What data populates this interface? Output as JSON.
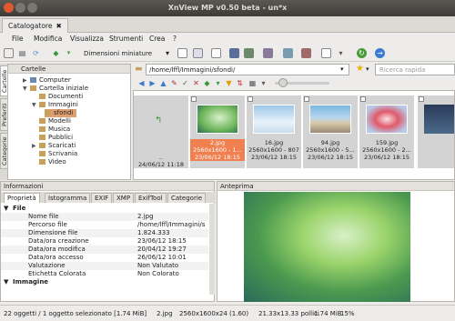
{
  "window": {
    "title": "XnView MP v0.50 beta - un*x"
  },
  "tab": {
    "label": "Catalogatore",
    "close": "✖"
  },
  "menu": [
    "File",
    "Modifica",
    "Visualizza",
    "Strumenti",
    "Crea",
    "?"
  ],
  "toolbar": {
    "dim_label": "Dimensioni miniature"
  },
  "side_tabs": [
    "Cartelle",
    "Preferiti",
    "Categorie"
  ],
  "folders": {
    "header": "Cartelle",
    "items": [
      "Computer",
      "Cartella iniziale",
      "Documenti",
      "Immagini",
      "sfondi",
      "Modelli",
      "Musica",
      "Pubblici",
      "Scaricati",
      "Scrivania",
      "Video"
    ]
  },
  "path": {
    "value": "/home/lffl/Immagini/sfondi/",
    "search_placeholder": "Ricerca rapida"
  },
  "thumbs": [
    {
      "name": "..",
      "line2": "",
      "line3": "24/06/12 11:18"
    },
    {
      "name": "2.jpg",
      "line2": "2560x1600 - 1...",
      "line3": "23/06/12 18:15"
    },
    {
      "name": "16.jpg",
      "line2": "2560x1600 - 807",
      "line3": "23/06/12 18:15"
    },
    {
      "name": "94.jpg",
      "line2": "2560x1600 - 5...",
      "line3": "23/06/12 18:15"
    },
    {
      "name": "159.jpg",
      "line2": "2560x1600 - 2...",
      "line3": "23/06/12 18:15"
    }
  ],
  "info": {
    "header": "Informazioni",
    "tabs": [
      "Proprietà",
      "Istogramma",
      "EXIF",
      "XMP",
      "ExifTool",
      "Categorie"
    ],
    "section_file": "File",
    "rows": [
      {
        "k": "Nome file",
        "v": "2.jpg"
      },
      {
        "k": "Percorso file",
        "v": "/home/lffl/Immagini/s"
      },
      {
        "k": "Dimensione file",
        "v": "1.824.333"
      },
      {
        "k": "Data/ora creazione",
        "v": "23/06/12 18:15"
      },
      {
        "k": "Data/ora modifica",
        "v": "20/04/12 19:27"
      },
      {
        "k": "Data/ora accesso",
        "v": "26/06/12 10:01"
      },
      {
        "k": "Valutazione",
        "v": "Non Valutato"
      },
      {
        "k": "Etichetta Colorata",
        "v": "Non Colorato"
      }
    ],
    "section_image": "Immagine"
  },
  "preview": {
    "header": "Anteprima"
  },
  "status": {
    "count": "22 oggetti / 1 oggetto selezionato [1.74 MiB]",
    "file": "2.jpg",
    "dims": "2560x1600x24 (1.60)",
    "inches": "21.33x13.33 pollici",
    "size": "1.74 MiB",
    "zoom": "15%"
  }
}
